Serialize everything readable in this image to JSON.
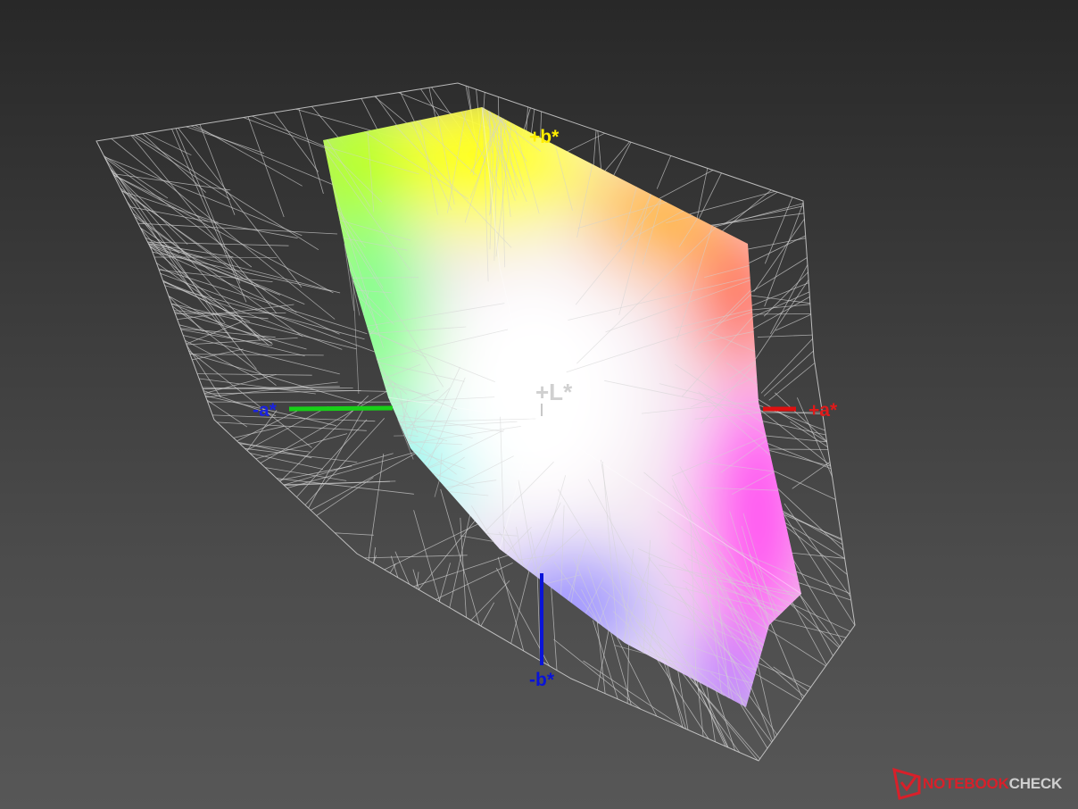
{
  "chart_data": {
    "type": "3d-gamut",
    "title": "",
    "axes": {
      "plus_b": "+b*",
      "minus_b": "-b*",
      "plus_a": "+a*",
      "minus_a": "-a*",
      "plus_l": "+L*"
    },
    "axis_colors": {
      "plus_b": "#ffee00",
      "minus_b": "#0a14d8",
      "plus_a": "#e01a1a",
      "minus_a": "#1a22e0",
      "green_axis": "#18d018",
      "red_axis": "#e01010",
      "l_axis": "#c8c8c8"
    },
    "gamut_colors": {
      "yellow": "#ffff1c",
      "yellow_green": "#b4ff1e",
      "green": "#7aff82",
      "cyan": "#6ef7ee",
      "blue": "#8c82ff",
      "violet": "#b05cff",
      "magenta": "#ff3cf0",
      "red": "#ff5a3c",
      "orange": "#ffb21e",
      "white": "#ffffff"
    },
    "reference_volume": {
      "style": "wireframe",
      "color": "#d2d2d2"
    }
  },
  "logo": {
    "word_1": "NOTEBOOK",
    "word_2": "CHECK",
    "colors": {
      "red": "#d8202a",
      "grey": "#cfcfcf"
    }
  }
}
